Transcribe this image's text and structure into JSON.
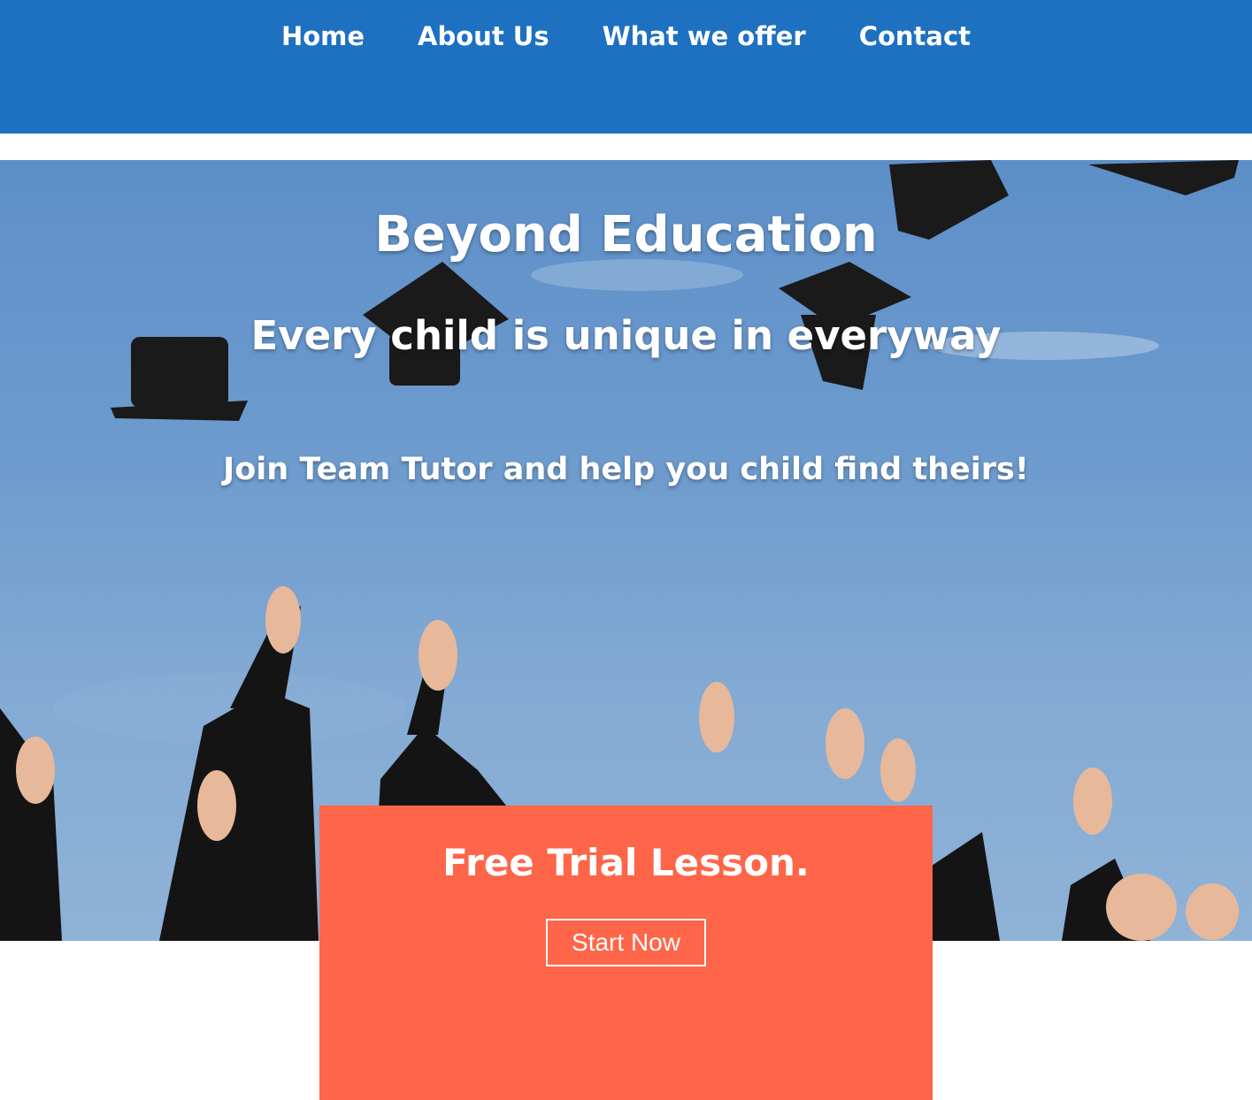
{
  "nav": {
    "items": [
      {
        "label": "Home"
      },
      {
        "label": "About Us"
      },
      {
        "label": "What we offer"
      },
      {
        "label": "Contact"
      }
    ]
  },
  "hero": {
    "title": "Beyond Education",
    "subtitle": "Every child is unique in everyway",
    "tagline": "Join Team Tutor and help you child find theirs!",
    "image": "graduates-throwing-caps-photo"
  },
  "trial": {
    "title": "Free Trial Lesson.",
    "button_label": "Start Now"
  },
  "colors": {
    "nav_background": "#1e70c1",
    "trial_background": "#ff6548",
    "text": "#ffffff"
  }
}
